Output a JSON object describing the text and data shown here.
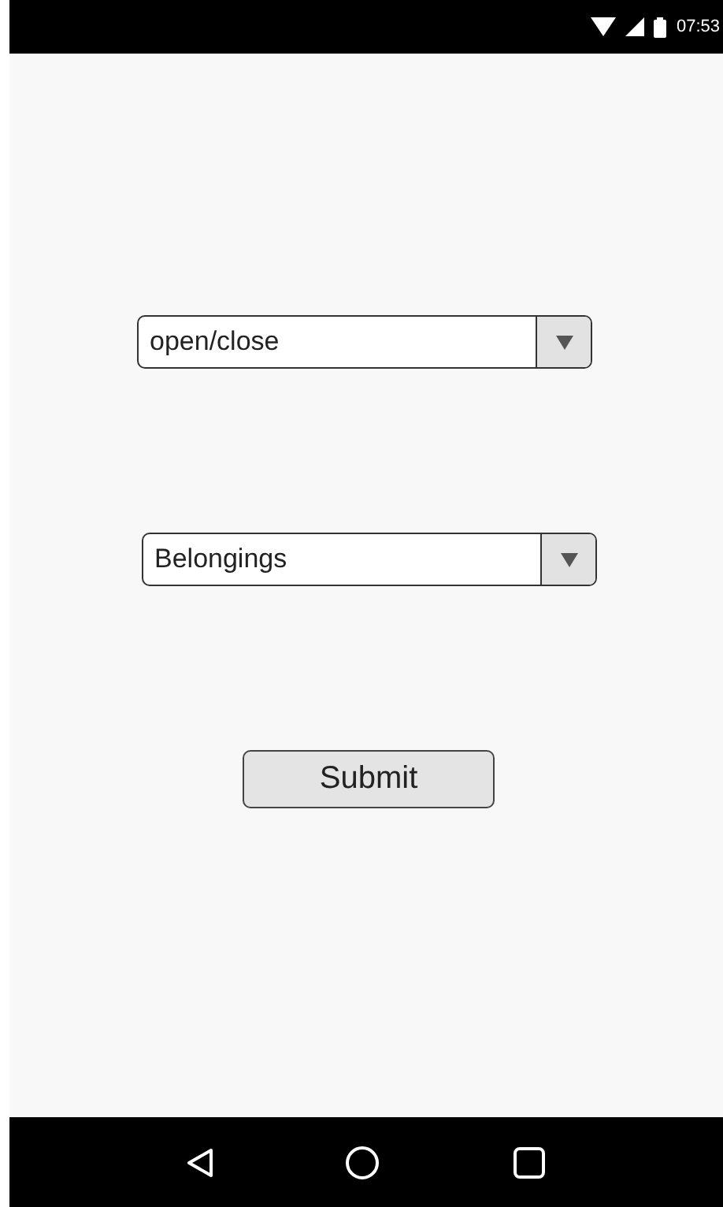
{
  "status_bar": {
    "time": "07:53"
  },
  "dropdowns": [
    {
      "value": "open/close"
    },
    {
      "value": "Belongings"
    }
  ],
  "submit_button": {
    "label": "Submit"
  }
}
